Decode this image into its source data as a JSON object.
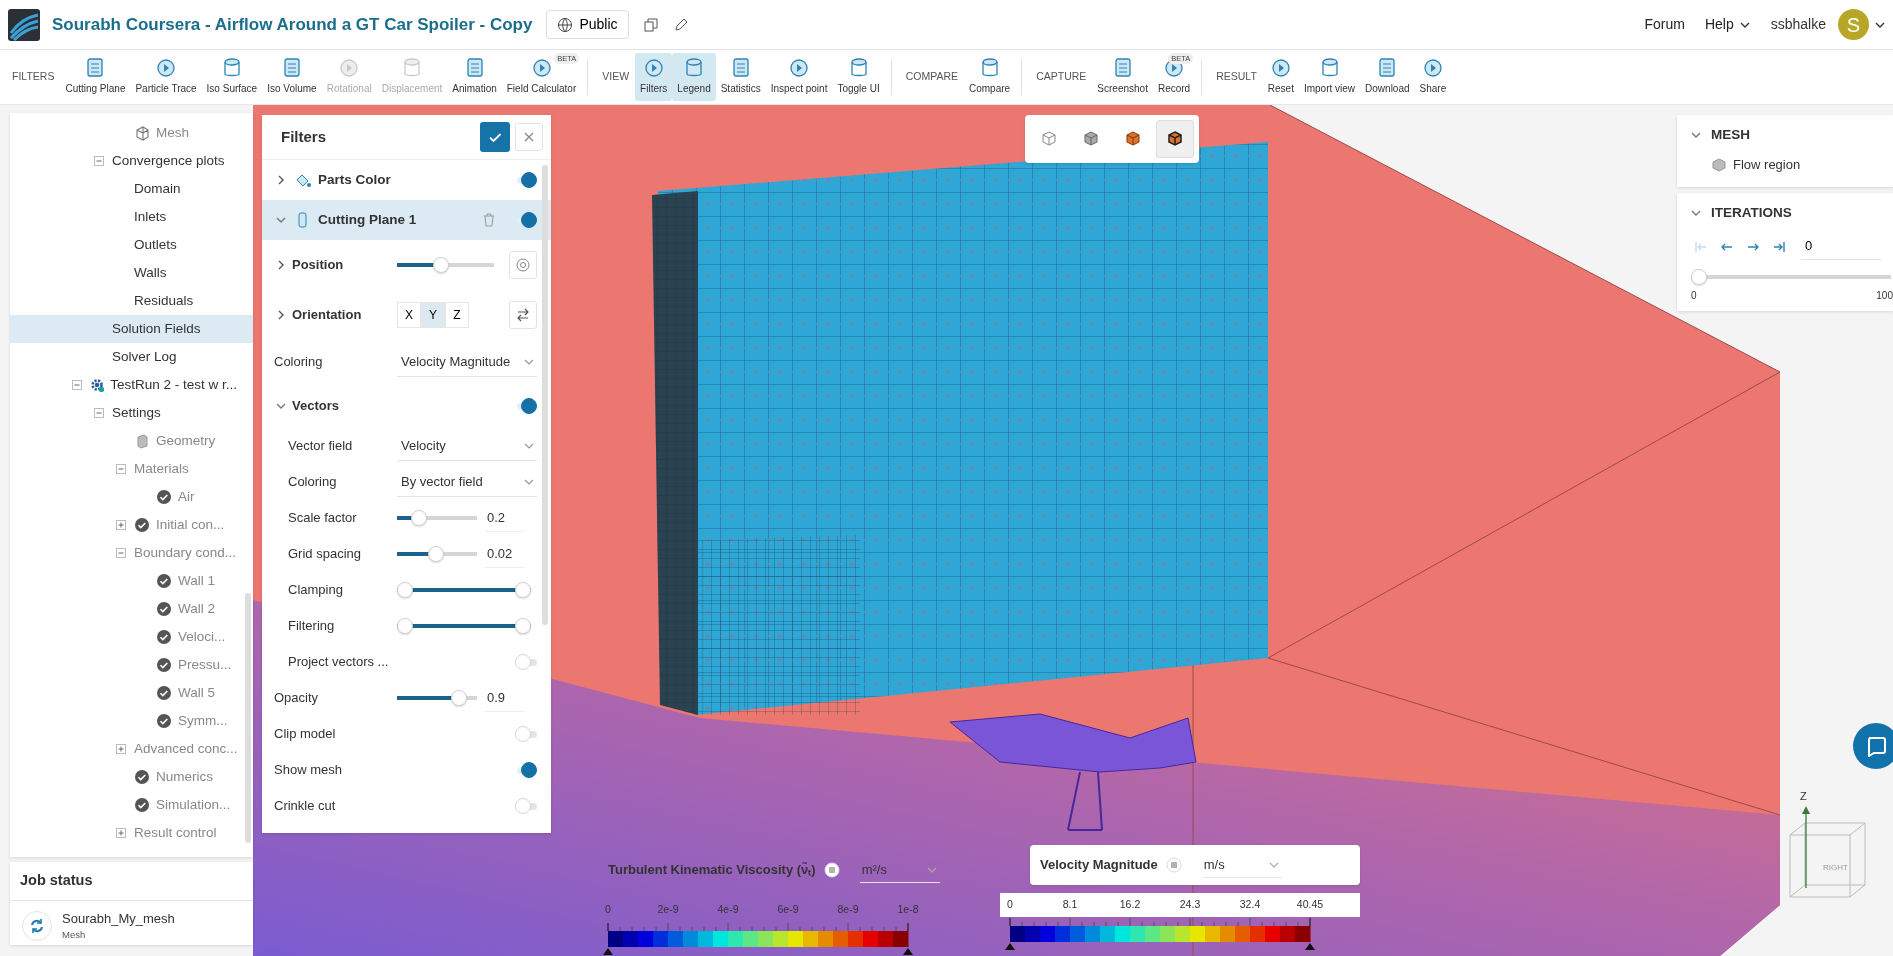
{
  "header": {
    "title": "Sourabh Coursera - Airflow Around a GT Car Spoiler - Copy",
    "visibility": "Public",
    "links": [
      {
        "label": "Forum",
        "menu": false
      },
      {
        "label": "Help",
        "menu": true
      }
    ],
    "user": "ssbhalke",
    "avatar_initial": "S"
  },
  "toolbar": [
    {
      "label": "FILTERS",
      "items": [
        {
          "label": "Cutting Plane",
          "disabled": false,
          "selected": false
        },
        {
          "label": "Particle Trace",
          "disabled": false,
          "selected": false
        },
        {
          "label": "Iso Surface",
          "disabled": false,
          "selected": false
        },
        {
          "label": "Iso Volume",
          "disabled": false,
          "selected": false
        },
        {
          "label": "Rotational",
          "disabled": true,
          "selected": false
        },
        {
          "label": "Displacement",
          "disabled": true,
          "selected": false
        },
        {
          "label": "Animation",
          "disabled": false,
          "selected": false
        },
        {
          "label": "Field Calculator",
          "disabled": false,
          "selected": false,
          "badge": "BETA"
        }
      ]
    },
    {
      "label": "VIEW",
      "items": [
        {
          "label": "Filters",
          "disabled": false,
          "selected": true
        },
        {
          "label": "Legend",
          "disabled": false,
          "selected": true
        },
        {
          "label": "Statistics",
          "disabled": false,
          "selected": false
        },
        {
          "label": "Inspect point",
          "disabled": false,
          "selected": false
        },
        {
          "label": "Toggle UI",
          "disabled": false,
          "selected": false
        }
      ]
    },
    {
      "label": "COMPARE",
      "items": [
        {
          "label": "Compare",
          "disabled": false,
          "selected": false
        }
      ]
    },
    {
      "label": "CAPTURE",
      "items": [
        {
          "label": "Screenshot",
          "disabled": false,
          "selected": false
        },
        {
          "label": "Record",
          "disabled": false,
          "selected": false,
          "badge": "BETA"
        }
      ]
    },
    {
      "label": "RESULT",
      "items": [
        {
          "label": "Reset",
          "disabled": false,
          "selected": false
        },
        {
          "label": "Import view",
          "disabled": false,
          "selected": false
        },
        {
          "label": "Download",
          "disabled": false,
          "selected": false
        },
        {
          "label": "Share",
          "disabled": false,
          "selected": false
        }
      ]
    }
  ],
  "tree": [
    {
      "children": [
        {
          "children": [
            {
              "label": "Mesh",
              "kind": "mesh",
              "muted": true,
              "selected": false
            }
          ]
        },
        {
          "label": "Convergence plots",
          "expanded": true,
          "muted": false,
          "selected": false,
          "children": [
            {
              "label": "Domain",
              "muted": false,
              "selected": false
            },
            {
              "label": "Inlets",
              "muted": false,
              "selected": false
            },
            {
              "label": "Outlets",
              "muted": false,
              "selected": false
            },
            {
              "label": "Walls",
              "muted": false,
              "selected": false
            },
            {
              "label": "Residuals",
              "muted": false,
              "selected": false
            }
          ]
        },
        {
          "label": "Solution Fields",
          "muted": false,
          "selected": true
        },
        {
          "label": "Solver Log",
          "muted": false,
          "selected": false
        }
      ]
    },
    {
      "label": "TestRun 2 - test w r...",
      "kind": "run",
      "expanded": true,
      "muted": false,
      "selected": false,
      "children": [
        {
          "label": "Settings",
          "expanded": true,
          "muted": false,
          "selected": false,
          "children": [
            {
              "label": "Geometry",
              "kind": "geometry",
              "muted": true,
              "selected": false
            },
            {
              "label": "Materials",
              "expanded": true,
              "muted": true,
              "selected": false,
              "children": [
                {
                  "label": "Air",
                  "kind": "check",
                  "muted": true,
                  "selected": false
                }
              ]
            },
            {
              "label": "Initial con...",
              "kind": "check",
              "expanded": false,
              "muted": true,
              "selected": false
            },
            {
              "label": "Boundary cond...",
              "expanded": true,
              "muted": true,
              "selected": false,
              "children": [
                {
                  "label": "Wall 1",
                  "kind": "check",
                  "muted": true,
                  "selected": false
                },
                {
                  "label": "Wall 2",
                  "kind": "check",
                  "muted": true,
                  "selected": false
                },
                {
                  "label": "Veloci...",
                  "kind": "check",
                  "muted": true,
                  "selected": false
                },
                {
                  "label": "Pressu...",
                  "kind": "check",
                  "muted": true,
                  "selected": false
                },
                {
                  "label": "Wall 5",
                  "kind": "check",
                  "muted": true,
                  "selected": false
                },
                {
                  "label": "Symm...",
                  "kind": "check",
                  "muted": true,
                  "selected": false
                }
              ]
            },
            {
              "label": "Advanced conc...",
              "expanded": false,
              "muted": true,
              "selected": false
            },
            {
              "label": "Numerics",
              "kind": "check",
              "muted": true,
              "selected": false
            },
            {
              "label": "Simulation...",
              "kind": "check",
              "muted": true,
              "selected": false
            },
            {
              "label": "Result control",
              "expanded": false,
              "muted": true,
              "selected": false
            }
          ]
        }
      ]
    }
  ],
  "job_status": {
    "title": "Job status",
    "jobs": [
      {
        "name": "Sourabh_My_mesh",
        "type": "Mesh"
      }
    ]
  },
  "filters": {
    "title": "Filters",
    "layers": [
      {
        "label": "Parts Color",
        "expanded": false,
        "on": true,
        "selected": false
      },
      {
        "label": "Cutting Plane 1",
        "expanded": true,
        "on": true,
        "selected": true,
        "children": [
          {
            "kind": "slider",
            "label": "Position",
            "expanded": false,
            "level": 0.45,
            "target_button": true
          },
          {
            "kind": "axis",
            "label": "Orientation",
            "expanded": false,
            "flip_button": true,
            "axes": [
              {
                "label": "X",
                "selected": false
              },
              {
                "label": "Y",
                "selected": true
              },
              {
                "label": "Z",
                "selected": false
              }
            ]
          },
          {
            "kind": "select",
            "label": "Coloring",
            "value": "Velocity Magnitude"
          },
          {
            "kind": "group",
            "label": "Vectors",
            "expanded": true,
            "on": true,
            "children": [
              {
                "kind": "select",
                "label": "Vector field",
                "value": "Velocity"
              },
              {
                "kind": "select",
                "label": "Coloring",
                "value": "By vector field"
              },
              {
                "kind": "slider",
                "label": "Scale factor",
                "level": 0.22,
                "reading": "0.2"
              },
              {
                "kind": "slider",
                "label": "Grid spacing",
                "level": 0.48,
                "reading": "0.02"
              },
              {
                "kind": "range",
                "label": "Clamping",
                "handles": [
                  {
                    "level": 0
                  },
                  {
                    "level": 1
                  }
                ]
              },
              {
                "kind": "range",
                "label": "Filtering",
                "handles": [
                  {
                    "level": 0
                  },
                  {
                    "level": 1
                  }
                ]
              },
              {
                "kind": "toggle",
                "label": "Project vectors ...",
                "on": false
              }
            ]
          },
          {
            "kind": "slider",
            "label": "Opacity",
            "level": 0.85,
            "reading": "0.9"
          },
          {
            "kind": "toggle",
            "label": "Clip model",
            "on": false
          },
          {
            "kind": "toggle",
            "label": "Show mesh",
            "on": true
          },
          {
            "kind": "toggle",
            "label": "Crinkle cut",
            "on": false
          }
        ]
      }
    ]
  },
  "render_modes": [
    {
      "selected": false
    },
    {
      "selected": false
    },
    {
      "selected": false
    },
    {
      "selected": true
    }
  ],
  "mesh_panel": {
    "title": "MESH",
    "expanded": true,
    "items": [
      "Flow region"
    ]
  },
  "iterations": {
    "title": "ITERATIONS",
    "expanded": true,
    "value": "0",
    "level": 0,
    "min": "0",
    "max": "100",
    "buttons": [
      {
        "disabled": true
      },
      {
        "disabled": false
      },
      {
        "disabled": false
      },
      {
        "disabled": false
      }
    ]
  },
  "legends": [
    {
      "title": "Turbulent Kinematic Viscosity (ν̃ₜ)",
      "unit": "m²/s",
      "selected": false,
      "ticks": [
        "0",
        "2e-9",
        "4e-9",
        "6e-9",
        "8e-9",
        "1e-8"
      ]
    },
    {
      "title": "Velocity Magnitude",
      "unit": "m/s",
      "selected": true,
      "ticks": [
        "0",
        "8.1",
        "16.2",
        "24.3",
        "32.4",
        "40.45"
      ]
    }
  ],
  "orientation_cube": {
    "axis_label": "Z",
    "face_label": "RIGHT"
  }
}
